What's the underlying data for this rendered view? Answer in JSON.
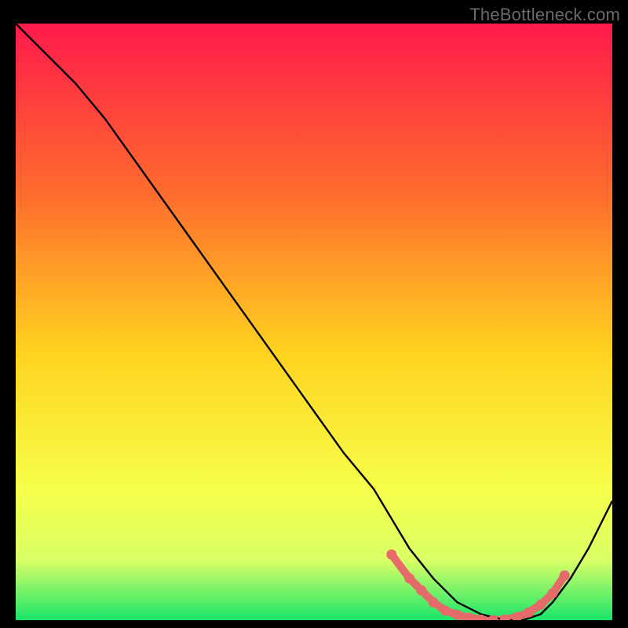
{
  "watermark": "TheBottleneck.com",
  "colors": {
    "bg": "#000000",
    "curve": "#000000",
    "marker": "#e66a6a",
    "gradient_top": "#ff1a4b",
    "gradient_mid_upper": "#ff6a2e",
    "gradient_mid": "#ffd21f",
    "gradient_mid_lower": "#f6ff4a",
    "gradient_low": "#d9ff66",
    "gradient_bottom": "#19e56a"
  },
  "chart_data": {
    "type": "line",
    "title": "",
    "xlabel": "",
    "ylabel": "",
    "xlim": [
      0,
      100
    ],
    "ylim": [
      0,
      100
    ],
    "curve": {
      "x": [
        0,
        6,
        10,
        15,
        20,
        25,
        30,
        35,
        40,
        45,
        50,
        55,
        60,
        63,
        66,
        70,
        74,
        78,
        82,
        85,
        88,
        90,
        93,
        96,
        100
      ],
      "y": [
        100,
        94,
        90,
        84,
        77,
        70,
        63,
        56,
        49,
        42,
        35,
        28,
        22,
        17,
        12,
        7,
        3,
        1,
        0,
        0,
        1,
        3,
        7,
        12,
        20
      ]
    },
    "marker_zone": {
      "x": [
        63,
        66,
        68,
        70,
        72,
        74,
        76,
        78,
        80,
        82,
        84,
        86,
        88,
        90,
        92
      ],
      "y": [
        11,
        7,
        5,
        3,
        1.6,
        0.9,
        0.4,
        0.1,
        0.0,
        0.1,
        0.5,
        1.3,
        2.6,
        4.5,
        7.5
      ]
    }
  }
}
